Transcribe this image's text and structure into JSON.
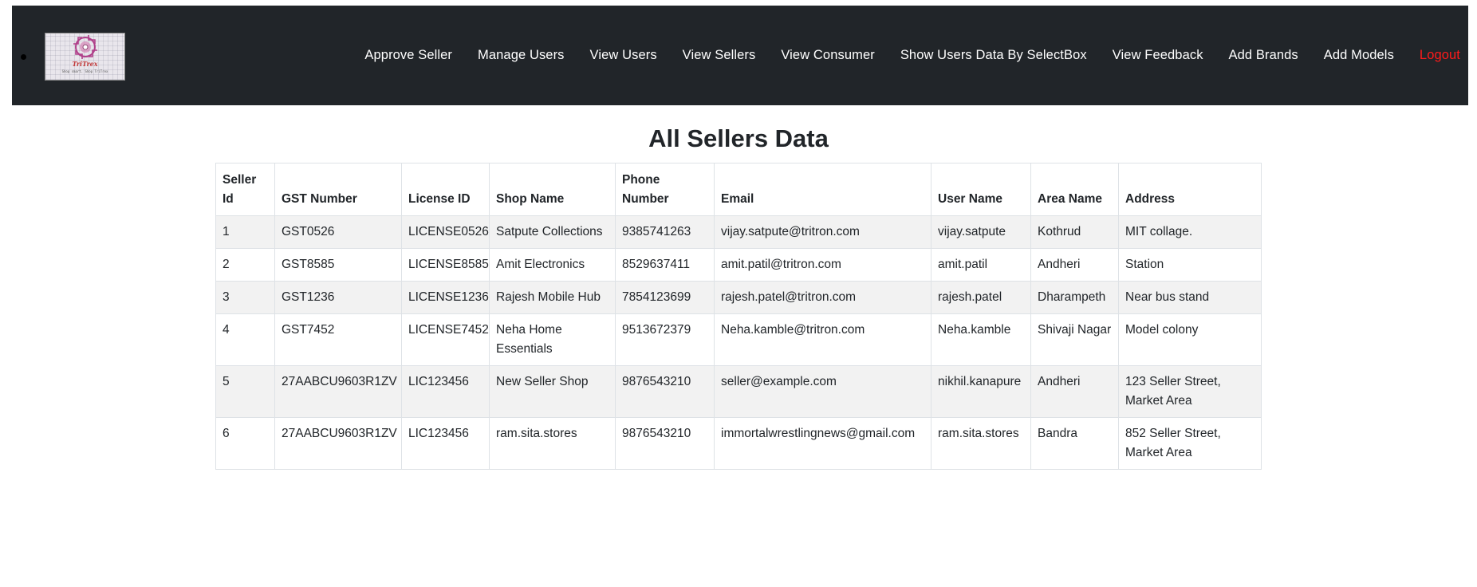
{
  "navbar": {
    "logo": {
      "name": "TriTrex",
      "tagline": "Shop smart. Shop TriTrex"
    },
    "links": [
      {
        "label": "Approve Seller"
      },
      {
        "label": "Manage Users"
      },
      {
        "label": "View Users"
      },
      {
        "label": "View Sellers"
      },
      {
        "label": "View Consumer"
      },
      {
        "label": "Show Users Data By SelectBox"
      },
      {
        "label": "View Feedback"
      },
      {
        "label": "Add Brands"
      },
      {
        "label": "Add Models"
      },
      {
        "label": "Logout",
        "color": "#ff1a1a"
      }
    ]
  },
  "page": {
    "title": "All Sellers Data"
  },
  "table": {
    "headers": [
      "Seller Id",
      "GST Number",
      "License ID",
      "Shop Name",
      "Phone Number",
      "Email",
      "User Name",
      "Area Name",
      "Address"
    ],
    "rows": [
      [
        "1",
        "GST0526",
        "LICENSE0526",
        "Satpute Collections",
        "9385741263",
        "vijay.satpute@tritron.com",
        "vijay.satpute",
        "Kothrud",
        "MIT collage."
      ],
      [
        "2",
        "GST8585",
        "LICENSE8585",
        "Amit Electronics",
        "8529637411",
        "amit.patil@tritron.com",
        "amit.patil",
        "Andheri",
        "Station"
      ],
      [
        "3",
        "GST1236",
        "LICENSE1236",
        "Rajesh Mobile Hub",
        "7854123699",
        "rajesh.patel@tritron.com",
        "rajesh.patel",
        "Dharampeth",
        "Near bus stand"
      ],
      [
        "4",
        "GST7452",
        "LICENSE7452",
        "Neha Home Essentials",
        "9513672379",
        "Neha.kamble@tritron.com",
        "Neha.kamble",
        "Shivaji Nagar",
        "Model colony"
      ],
      [
        "5",
        "27AABCU9603R1ZV",
        "LIC123456",
        "New Seller Shop",
        "9876543210",
        "seller@example.com",
        "nikhil.kanapure",
        "Andheri",
        "123 Seller Street, Market Area"
      ],
      [
        "6",
        "27AABCU9603R1ZV",
        "LIC123456",
        "ram.sita.stores",
        "9876543210",
        "immortalwrestlingnews@gmail.com",
        "ram.sita.stores",
        "Bandra",
        "852 Seller Street, Market Area"
      ]
    ]
  },
  "colors": {
    "navbar_bg": "#212529",
    "logout": "#ff1a1a",
    "striped_row": "#f2f2f2",
    "border": "#dee2e6"
  }
}
